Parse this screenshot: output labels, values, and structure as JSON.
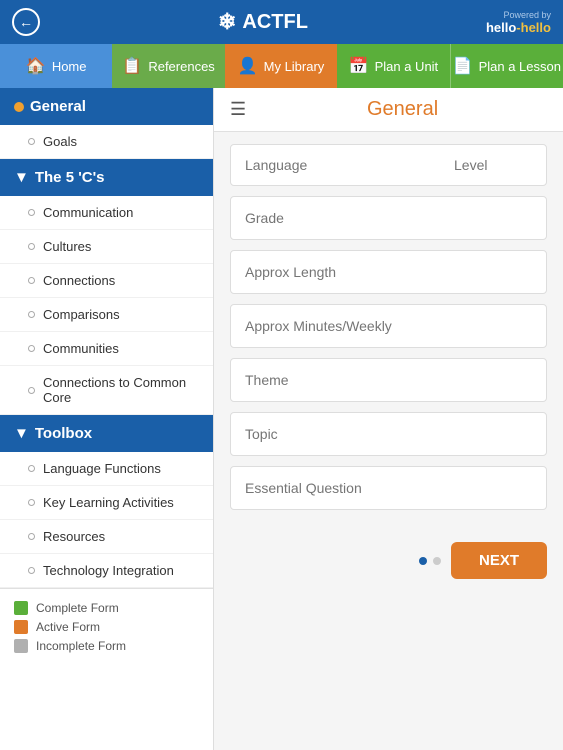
{
  "topbar": {
    "back_icon": "←",
    "logo_snowflake": "❄",
    "logo_text": "ACTFL",
    "powered_by": "Powered by",
    "hello_hello": "hello-hello"
  },
  "navbar": {
    "items": [
      {
        "id": "home",
        "label": "Home",
        "icon": "🏠",
        "class": "nav-home"
      },
      {
        "id": "references",
        "label": "References",
        "icon": "📋",
        "class": "nav-references"
      },
      {
        "id": "my-library",
        "label": "My Library",
        "icon": "👤",
        "class": "nav-library"
      },
      {
        "id": "plan-unit",
        "label": "Plan a Unit",
        "icon": "📅",
        "class": "nav-plan-unit"
      },
      {
        "id": "plan-lesson",
        "label": "Plan a Lesson",
        "icon": "📄",
        "class": "nav-plan-lesson"
      }
    ]
  },
  "sidebar": {
    "general_label": "General",
    "goals_label": "Goals",
    "five_cs_label": "The 5 'C's",
    "items_5cs": [
      {
        "id": "communication",
        "label": "Communication"
      },
      {
        "id": "cultures",
        "label": "Cultures"
      },
      {
        "id": "connections",
        "label": "Connections"
      },
      {
        "id": "comparisons",
        "label": "Comparisons"
      },
      {
        "id": "communities",
        "label": "Communities"
      },
      {
        "id": "connections-common-core",
        "label": "Connections to Common Core"
      }
    ],
    "toolbox_label": "Toolbox",
    "toolbox_items": [
      {
        "id": "language-functions",
        "label": "Language Functions"
      },
      {
        "id": "key-learning-activities",
        "label": "Key Learning Activities"
      },
      {
        "id": "resources",
        "label": "Resources"
      },
      {
        "id": "technology-integration",
        "label": "Technology Integration"
      }
    ],
    "legend": [
      {
        "id": "complete",
        "color": "legend-green",
        "label": "Complete Form"
      },
      {
        "id": "active",
        "color": "legend-orange",
        "label": "Active Form"
      },
      {
        "id": "incomplete",
        "color": "legend-gray",
        "label": "Incomplete Form"
      }
    ]
  },
  "content": {
    "hamburger": "☰",
    "title": "General",
    "form": {
      "language_placeholder": "Language",
      "level_placeholder": "Level",
      "grade_label": "Grade",
      "approx_length_label": "Approx Length",
      "approx_minutes_label": "Approx Minutes/Weekly",
      "theme_label": "Theme",
      "topic_label": "Topic",
      "essential_question_label": "Essential Question"
    },
    "footer": {
      "next_label": "NEXT",
      "dots": [
        true,
        false
      ]
    }
  }
}
